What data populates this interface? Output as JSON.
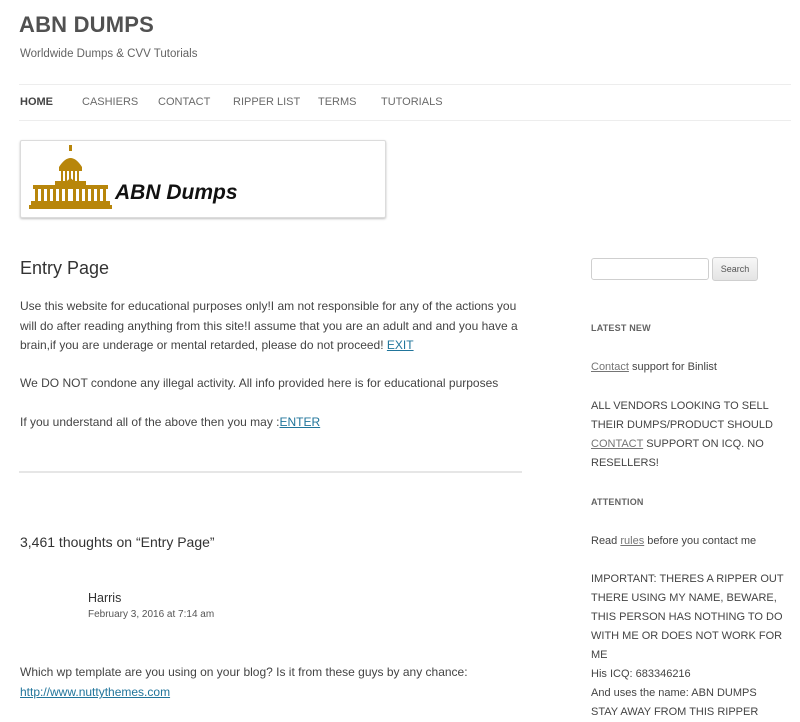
{
  "site": {
    "title": "ABN DUMPS",
    "description": "Worldwide Dumps & CVV Tutorials"
  },
  "nav": [
    "HOME",
    "CASHIERS",
    "CONTACT",
    "RIPPER LIST",
    "TERMS",
    "TUTORIALS"
  ],
  "banner": {
    "text": "ABN Dumps"
  },
  "page": {
    "title": "Entry Page",
    "intro_text": "Use this website for educational purposes only!I am not responsible for any of the actions you will do after reading anything from this site!I assume that you are an adult and and you have a brain,if you are underage or mental retarded, please do not proceed! ",
    "exit_link": "EXIT",
    "disclaimer": "We DO NOT condone any illegal activity. All info provided here is for educational purposes",
    "enter_text": "If you understand all of the above then you may :",
    "enter_link": "ENTER"
  },
  "comments": {
    "title": "3,461 thoughts on “Entry Page”",
    "items": [
      {
        "author": "Harris",
        "date": "February 3, 2016 at 7:14 am",
        "text": "Which wp template are you using on your blog? Is it from these guys by any chance:",
        "link": "http://www.nuttythemes.com"
      }
    ]
  },
  "sidebar": {
    "search_button": "Search",
    "latest_title": "LATEST NEW",
    "latest_line1_link": "Contact",
    "latest_line1_text": " support for Binlist",
    "latest_line2_pre": "ALL VENDORS LOOKING TO SELL THEIR DUMPS/PRODUCT SHOULD ",
    "latest_line2_link": "CONTACT",
    "latest_line2_post": " SUPPORT ON ICQ. NO RESELLERS!",
    "attention_title": "ATTENTION",
    "attention_line1_pre": "Read ",
    "attention_line1_link": "rules",
    "attention_line1_post": " before you contact me",
    "attention_body": "IMPORTANT: THERES A RIPPER OUT THERE USING MY NAME, BEWARE, THIS PERSON HAS NOTHING TO DO WITH ME OR DOES NOT WORK FOR ME",
    "icq": "His ICQ: 683346216",
    "uses_name": "And uses the name: ABN DUMPS",
    "stay_away": "STAY AWAY FROM THIS RIPPER"
  },
  "colors": {
    "link": "#21759b",
    "banner_gold": "#b8860b"
  }
}
